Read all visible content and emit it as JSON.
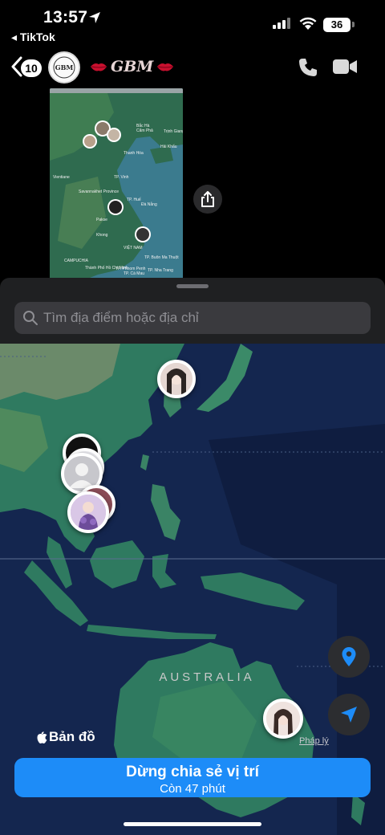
{
  "status_bar": {
    "time": "13:57",
    "back_app": "◂ TikTok",
    "battery": "36"
  },
  "chat_header": {
    "unread_count": "10",
    "title": "GBM",
    "avatar_lettering": "GBM"
  },
  "preview_map": {
    "labels": [
      "Bắc Hà",
      "Cẩm Phả",
      "Trịnh Giang",
      "Hải Khẩu",
      "Thanh Hóa",
      "TP. Vinh",
      "Vientiane",
      "Savannakhet Province",
      "TP. Huế",
      "Đà Nẵng",
      "Pakse",
      "Khong",
      "VIỆT NAM",
      "TP. Buôn Ma Thuột",
      "CAMPUCHIA",
      "TP. Nha Trang",
      "TP. Phnom Penh",
      "Thành Phố Hồ Chí Minh",
      "TP. Cà Mau"
    ]
  },
  "search": {
    "placeholder": "Tìm địa điểm hoặc địa chỉ"
  },
  "map": {
    "region_label": "AUSTRALIA",
    "attribution": "Bản đồ",
    "legal": "Pháp lý"
  },
  "stop_sharing": {
    "title": "Dừng chia sẻ vị trí",
    "subtitle": "Còn 47 phút"
  },
  "colors": {
    "accent": "#1d8cf8",
    "sheet": "#1f2022",
    "ocean": "#12224a",
    "land": "#2e7a62"
  },
  "icons": [
    "location-arrow-icon",
    "chevron-left-icon",
    "phone-icon",
    "video-camera-icon",
    "share-icon",
    "search-icon",
    "location-pin-icon",
    "navigation-arrow-icon",
    "apple-logo-icon"
  ]
}
